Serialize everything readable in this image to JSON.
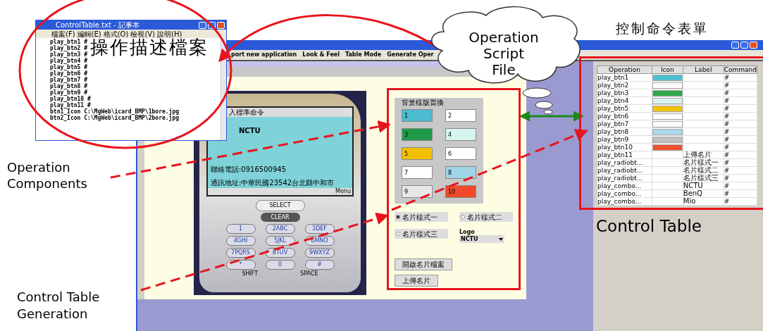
{
  "notepad": {
    "title": "ControlTable.txt - 記事本",
    "menu": [
      "檔案(F)",
      "編輯(E)",
      "格式(O)",
      "檢視(V)",
      "說明(H)"
    ],
    "lines": [
      "play_btn1 #",
      "play_btn2 #",
      "play_btn3 #",
      "play_btn4 #",
      "play_btn5 #",
      "play_btn6 #",
      "play_btn7 #",
      "play_btn8 #",
      "play_btn9 #",
      "play_btn10 #",
      "play_btn11 #",
      "btn1_Icon C:\\MgWeb\\icard_BMP\\1bore.jpg",
      "btn2_Icon C:\\MgWeb\\icard_BMP\\2bore.jpg"
    ]
  },
  "app": {
    "menu": [
      "port new application",
      "Look & Feel",
      "Table Mode",
      "Generate Oper"
    ],
    "phone": {
      "screen_title": "入標準命令",
      "company": "NCTU",
      "phone_line": "聯絡電話:0916500945",
      "address_line": "通訊地址:中華民國23542台北縣中和市",
      "softkey": "Menu",
      "select": "SELECT",
      "clear": "CLEAR",
      "keys": [
        "1",
        "2ABC",
        "3DEF",
        "4GHI",
        "5JKL",
        "6MNO",
        "7PQRS",
        "8TUV",
        "9WXYZ",
        "*",
        "0",
        "#"
      ],
      "shift": "SHIFT",
      "space": "SPACE"
    },
    "panel": {
      "group_title": "背景樣版置換",
      "swatches": [
        {
          "label": "1",
          "color": "#4cbcd0"
        },
        {
          "label": "2",
          "color": "#ffffff"
        },
        {
          "label": "3",
          "color": "#1f9a48"
        },
        {
          "label": "4",
          "color": "#d6f5ef"
        },
        {
          "label": "5",
          "color": "#f3c000"
        },
        {
          "label": "6",
          "color": "#ffffff"
        },
        {
          "label": "7",
          "color": "#ffffff"
        },
        {
          "label": "8",
          "color": "#9fd3e8"
        },
        {
          "label": "9",
          "color": "#e8e8e8"
        },
        {
          "label": "10",
          "color": "#f04a2a"
        }
      ],
      "radios": [
        {
          "label": "名片樣式一",
          "selected": true
        },
        {
          "label": "名片樣式二",
          "selected": false
        },
        {
          "label": "名片樣式三",
          "selected": false
        }
      ],
      "logo_label": "Logo",
      "logo_value": "NCTU",
      "buttons": [
        "開啟名片檔案",
        "上傳名片"
      ]
    },
    "table": {
      "columns": [
        "Operation",
        "Icon",
        "Label",
        "Command"
      ],
      "rows": [
        {
          "operation": "play_btn1",
          "color": "#4fc0d0",
          "label": "",
          "command": "#"
        },
        {
          "operation": "play_btn2",
          "color": "#ffffff",
          "label": "",
          "command": "#"
        },
        {
          "operation": "play_btn3",
          "color": "#2ea84a",
          "label": "",
          "command": "#"
        },
        {
          "operation": "play_btn4",
          "color": "#d8f4ee",
          "label": "",
          "command": "#"
        },
        {
          "operation": "play_btn5",
          "color": "#f2c300",
          "label": "",
          "command": "#"
        },
        {
          "operation": "play_btn6",
          "color": "#ffffff",
          "label": "",
          "command": "#"
        },
        {
          "operation": "play_btn7",
          "color": "#ffffff",
          "label": "",
          "command": "#"
        },
        {
          "operation": "play_btn8",
          "color": "#a8d8ea",
          "label": "",
          "command": "#"
        },
        {
          "operation": "play_btn9",
          "color": "#c0c0c0",
          "label": "",
          "command": "#"
        },
        {
          "operation": "play_btn10",
          "color": "#f05030",
          "label": "",
          "command": "#"
        },
        {
          "operation": "play_btn11",
          "label": "上傳名片",
          "command": "#"
        },
        {
          "operation": "play_radiobt...",
          "label": "名片樣式一",
          "command": "#"
        },
        {
          "operation": "play_radiobt...",
          "label": "名片樣式二",
          "command": "#"
        },
        {
          "operation": "play_radiobt...",
          "label": "名片樣式三",
          "command": "#"
        },
        {
          "operation": "play_combo...",
          "label": "NCTU",
          "command": "#"
        },
        {
          "operation": "play_combo...",
          "label": "BenQ",
          "command": "#"
        },
        {
          "operation": "play_combo...",
          "label": "Mio",
          "command": "#"
        }
      ]
    }
  },
  "annotations": {
    "notepad_caption": "操作描述檔案",
    "cloud": [
      "Operation",
      "Script",
      "File"
    ],
    "table_caption": "控制命令表單",
    "control_table": "Control Table",
    "components_label": [
      "Operation",
      "Components"
    ],
    "generation_label": [
      "Control Table",
      "Generation"
    ]
  }
}
